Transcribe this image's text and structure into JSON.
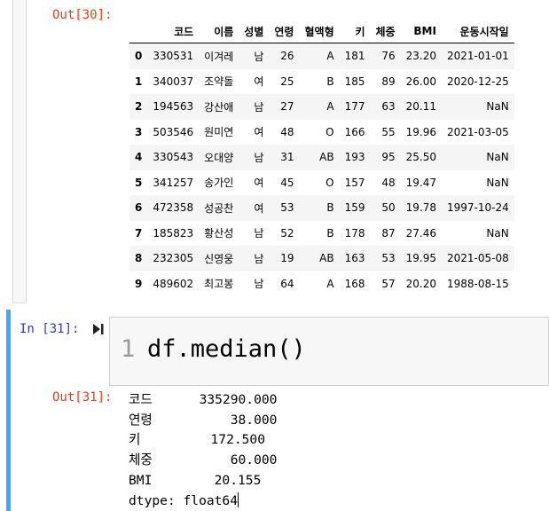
{
  "cell1": {
    "out_prompt": "Out[30]:",
    "columns": [
      "",
      "코드",
      "이름",
      "성별",
      "연령",
      "혈액형",
      "키",
      "체중",
      "BMI",
      "운동시작일"
    ],
    "rows": [
      [
        "0",
        "330531",
        "이겨레",
        "남",
        "26",
        "A",
        "181",
        "76",
        "23.20",
        "2021-01-01"
      ],
      [
        "1",
        "340037",
        "조약돌",
        "여",
        "25",
        "B",
        "185",
        "89",
        "26.00",
        "2020-12-25"
      ],
      [
        "2",
        "194563",
        "강산애",
        "남",
        "27",
        "A",
        "177",
        "63",
        "20.11",
        "NaN"
      ],
      [
        "3",
        "503546",
        "원미연",
        "여",
        "48",
        "O",
        "166",
        "55",
        "19.96",
        "2021-03-05"
      ],
      [
        "4",
        "330543",
        "오대양",
        "남",
        "31",
        "AB",
        "193",
        "95",
        "25.50",
        "NaN"
      ],
      [
        "5",
        "341257",
        "송가인",
        "여",
        "45",
        "O",
        "157",
        "48",
        "19.47",
        "NaN"
      ],
      [
        "6",
        "472358",
        "성공찬",
        "여",
        "53",
        "B",
        "159",
        "50",
        "19.78",
        "1997-10-24"
      ],
      [
        "7",
        "185823",
        "황산성",
        "남",
        "52",
        "B",
        "178",
        "87",
        "27.46",
        "NaN"
      ],
      [
        "8",
        "232305",
        "신영웅",
        "남",
        "19",
        "AB",
        "163",
        "53",
        "19.95",
        "2021-05-08"
      ],
      [
        "9",
        "489602",
        "최고봉",
        "남",
        "64",
        "A",
        "168",
        "57",
        "20.20",
        "1988-08-15"
      ]
    ]
  },
  "cell2": {
    "in_prompt": "In [31]:",
    "line_number": "1",
    "code": "df.median()",
    "out_prompt": "Out[31]:",
    "output_lines": [
      "코드      335290.000",
      "연령          38.000",
      "키         172.500",
      "체중          60.000",
      "BMI        20.155",
      "dtype: float64"
    ]
  },
  "icons": {
    "run": "run-cell-icon",
    "scrollbar": "scrollbar"
  }
}
